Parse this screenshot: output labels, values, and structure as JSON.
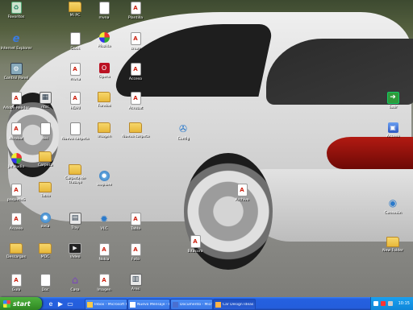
{
  "desktop": {
    "icons": [
      {
        "label": "Favoritos",
        "icon": "recycle-icon"
      },
      {
        "label": "Mi PC",
        "icon": "computer-icon"
      },
      {
        "label": "Internet Explorer",
        "icon": "internet-explorer-icon"
      },
      {
        "label": "Control Panel",
        "icon": "control-panel-icon"
      },
      {
        "label": "Adobe Reader",
        "icon": "pdf-icon"
      },
      {
        "label": "Acrobat",
        "icon": "pdf-icon"
      },
      {
        "label": "mvna",
        "icon": "application-icon"
      },
      {
        "label": "ntsc",
        "icon": "application-icon"
      },
      {
        "label": "cnum",
        "icon": "pdf-icon"
      },
      {
        "label": "dsc",
        "icon": "document-icon"
      },
      {
        "label": "HDMI",
        "icon": "pdf-icon"
      },
      {
        "label": "Nueva carpeta",
        "icon": "folder-icon"
      },
      {
        "label": "Carpeta",
        "icon": "folder-icon"
      },
      {
        "label": "Docs",
        "icon": "document-icon"
      },
      {
        "label": "ovca",
        "icon": "globe-icon"
      },
      {
        "label": "Tabla",
        "icon": "folder-icon"
      },
      {
        "label": "Nueva carpeta",
        "icon": "folder-icon"
      },
      {
        "label": "Imagen",
        "icon": "folder-icon"
      },
      {
        "label": "Jet Audio",
        "icon": "media-icon"
      },
      {
        "label": "Fondos",
        "icon": "pdf-icon"
      },
      {
        "label": "Plantilla",
        "icon": "pdf-icon"
      },
      {
        "label": "paqueteS",
        "icon": "pdf-icon"
      },
      {
        "label": "Carpeta de trabajo",
        "icon": "folder-icon"
      },
      {
        "label": "MDC",
        "icon": "folder-icon"
      },
      {
        "label": "VLC",
        "icon": "vlc-icon"
      },
      {
        "label": "Config",
        "icon": "gear-icon"
      },
      {
        "label": "iexplore",
        "icon": "globe-icon"
      },
      {
        "label": "Descargas",
        "icon": "folder-icon"
      },
      {
        "label": "Tray",
        "icon": "application-icon"
      },
      {
        "label": "Acceso",
        "icon": "pdf-icon"
      },
      {
        "label": "Acrobat",
        "icon": "pdf-icon"
      },
      {
        "label": "Tabla",
        "icon": "pdf-icon"
      },
      {
        "label": "Nokia",
        "icon": "pdf-icon"
      },
      {
        "label": "Foto",
        "icon": "pdf-icon"
      },
      {
        "label": "Doc",
        "icon": "document-icon"
      },
      {
        "label": "Casa",
        "icon": "house-icon"
      },
      {
        "label": "Imagen",
        "icon": "pdf-icon"
      },
      {
        "label": "Video",
        "icon": "video-icon"
      },
      {
        "label": "Mozilla",
        "icon": "multi-color-icon"
      },
      {
        "label": "Opera",
        "icon": "red-o-icon"
      },
      {
        "label": "Ares",
        "icon": "application-icon"
      },
      {
        "label": "Guía",
        "icon": "pdf-icon"
      },
      {
        "label": "Archivo",
        "icon": "pdf-icon"
      },
      {
        "label": "Salir",
        "icon": "exit-arrow-icon"
      },
      {
        "label": "Acceso",
        "icon": "blue-monitor-icon"
      },
      {
        "label": "Conexión",
        "icon": "gear-icon"
      },
      {
        "label": "New Folder",
        "icon": "folder-icon"
      },
      {
        "label": "Bitácora",
        "icon": "pdf-icon"
      }
    ]
  },
  "taskbar": {
    "start_label": "start",
    "quick_launch": [
      "ie-icon",
      "media-icon",
      "desktop-icon"
    ],
    "buttons": [
      {
        "label": "Inbox - Microsoft Out..."
      },
      {
        "label": "Nuevo Mensaje - Pos..."
      },
      {
        "label": "Documento - Micr..."
      },
      {
        "label": "Car Design Ideas - ..."
      }
    ],
    "clock": "10:15"
  },
  "colors": {
    "taskbar": "#245edb",
    "start": "#3c9a2d",
    "tray": "#0f86d8"
  }
}
